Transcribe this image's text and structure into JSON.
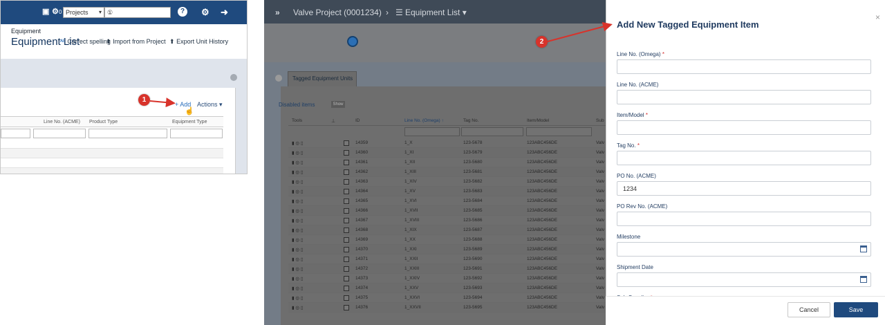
{
  "left_panel": {
    "toolbar": {
      "count_badge": "0",
      "project_select": "Projects",
      "version_value": "①"
    },
    "actions": {
      "correct_spelling": "Correct spelling",
      "import_from_project": "Import from Project",
      "export_unit_history": "Export Unit History"
    },
    "add_label": "+ Add",
    "actions_menu": "Actions ▾",
    "table_headers": [
      "Line No. (ACME)",
      "Product Type",
      "Equipment Type"
    ]
  },
  "markers": {
    "one": "1",
    "two": "2"
  },
  "middle_panel": {
    "breadcrumb": {
      "project": "Valve Project (0001234)",
      "page": "Equipment List ▾"
    },
    "section_label": "Equipment",
    "title": "Equipment List",
    "tab": "Tagged Equipment Units",
    "disabled_items": "Disabled items",
    "show_button": "Show",
    "table": {
      "headers": [
        "Tools",
        "ID",
        "Line No. (Omega) ↑",
        "Tag No.",
        "Item/Model",
        "Sub"
      ],
      "rows": [
        {
          "id": "14359",
          "line": "1_X",
          "tag": "123-5678",
          "item": "123ABC456DE",
          "sub": "Valv"
        },
        {
          "id": "14360",
          "line": "1_XI",
          "tag": "123-5679",
          "item": "123ABC456DE",
          "sub": "Valv"
        },
        {
          "id": "14361",
          "line": "1_XII",
          "tag": "123-5680",
          "item": "123ABC456DE",
          "sub": "Valv"
        },
        {
          "id": "14362",
          "line": "1_XIII",
          "tag": "123-5681",
          "item": "123ABC456DE",
          "sub": "Valv"
        },
        {
          "id": "14363",
          "line": "1_XIV",
          "tag": "123-5682",
          "item": "123ABC456DE",
          "sub": "Valv"
        },
        {
          "id": "14364",
          "line": "1_XV",
          "tag": "123-5683",
          "item": "123ABC456DE",
          "sub": "Valv"
        },
        {
          "id": "14365",
          "line": "1_XVI",
          "tag": "123-5684",
          "item": "123ABC456DE",
          "sub": "Valv"
        },
        {
          "id": "14366",
          "line": "1_XVII",
          "tag": "123-5685",
          "item": "123ABC456DE",
          "sub": "Valv"
        },
        {
          "id": "14367",
          "line": "1_XVIII",
          "tag": "123-5686",
          "item": "123ABC456DE",
          "sub": "Valv"
        },
        {
          "id": "14368",
          "line": "1_XIX",
          "tag": "123-5687",
          "item": "123ABC456DE",
          "sub": "Valv"
        },
        {
          "id": "14369",
          "line": "1_XX",
          "tag": "123-5688",
          "item": "123ABC456DE",
          "sub": "Valv"
        },
        {
          "id": "14370",
          "line": "1_XXI",
          "tag": "123-5689",
          "item": "123ABC456DE",
          "sub": "Valv"
        },
        {
          "id": "14371",
          "line": "1_XXII",
          "tag": "123-5690",
          "item": "123ABC456DE",
          "sub": "Valv"
        },
        {
          "id": "14372",
          "line": "1_XXIII",
          "tag": "123-5691",
          "item": "123ABC456DE",
          "sub": "Valv"
        },
        {
          "id": "14373",
          "line": "1_XXIV",
          "tag": "123-5692",
          "item": "123ABC456DE",
          "sub": "Valv"
        },
        {
          "id": "14374",
          "line": "1_XXV",
          "tag": "123-5693",
          "item": "123ABC456DE",
          "sub": "Valv"
        },
        {
          "id": "14375",
          "line": "1_XXVI",
          "tag": "123-5694",
          "item": "123ABC456DE",
          "sub": "Valv"
        },
        {
          "id": "14376",
          "line": "1_XXVII",
          "tag": "123-5695",
          "item": "123ABC456DE",
          "sub": "Valv"
        }
      ]
    }
  },
  "dialog": {
    "title": "Add New Tagged Equipment Item",
    "close": "×",
    "fields": [
      {
        "label": "Line No. (Omega)",
        "required": true,
        "value": ""
      },
      {
        "label": "Line No. (ACME)",
        "required": false,
        "value": ""
      },
      {
        "label": "Item/Model",
        "required": true,
        "value": ""
      },
      {
        "label": "Tag No.",
        "required": true,
        "value": ""
      },
      {
        "label": "PO No. (ACME)",
        "required": false,
        "value": "1234"
      },
      {
        "label": "PO Rev No. (ACME)",
        "required": false,
        "value": ""
      },
      {
        "label": "Milestone",
        "required": false,
        "value": "",
        "calendar": true
      },
      {
        "label": "Shipment Date",
        "required": false,
        "value": "",
        "calendar": true
      },
      {
        "label": "Sub-Supplier",
        "required": true,
        "value": ""
      }
    ],
    "cancel": "Cancel",
    "save": "Save"
  },
  "colors": {
    "brand_navy": "#1f4a7e",
    "marker_red": "#d8332b",
    "required_red": "#d32f2f",
    "link_blue": "#2a6ebb"
  }
}
